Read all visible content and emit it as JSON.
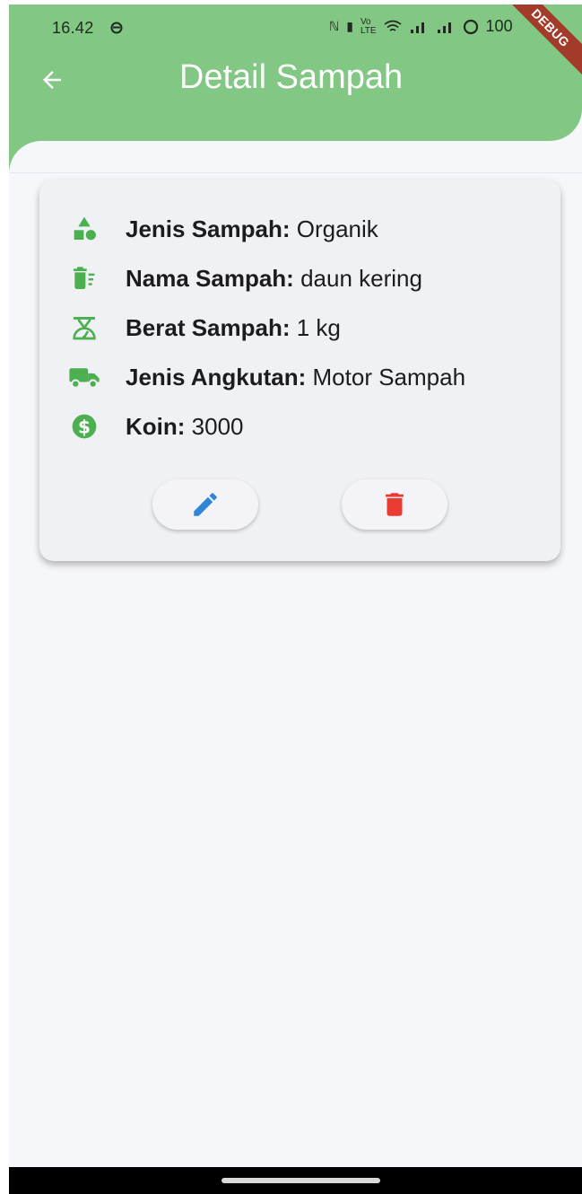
{
  "status_bar": {
    "time": "16.42",
    "icons": [
      "nfc-icon",
      "vibrate-icon",
      "volte-icon",
      "wifi-icon",
      "signal-icon",
      "signal-icon",
      "battery-ring-icon"
    ],
    "battery": "100",
    "debug_label": "DEBUG"
  },
  "app_bar": {
    "title": "Detail Sampah",
    "back_icon": "arrow-left-icon",
    "color": "#83c784"
  },
  "details": [
    {
      "icon": "category-shapes-icon",
      "label": "Jenis Sampah:",
      "value": " Organik"
    },
    {
      "icon": "trash-list-icon",
      "label": "Nama Sampah:",
      "value": " daun kering"
    },
    {
      "icon": "scale-icon",
      "label": "Berat Sampah:",
      "value": " 1 kg"
    },
    {
      "icon": "truck-icon",
      "label": "Jenis Angkutan:",
      "value": " Motor Sampah"
    },
    {
      "icon": "dollar-coin-icon",
      "label": "Koin:",
      "value": " 3000"
    }
  ],
  "actions": {
    "edit_icon": "pencil-icon",
    "edit_color": "#2f86d8",
    "delete_icon": "trash-icon",
    "delete_color": "#ea3b32"
  },
  "accent_green": "#4caf50"
}
